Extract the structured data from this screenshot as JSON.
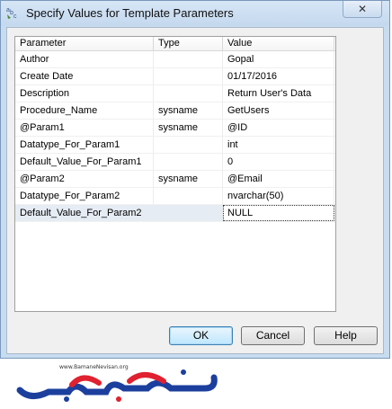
{
  "window": {
    "title": "Specify Values for Template Parameters",
    "close_glyph": "✕"
  },
  "grid": {
    "columns": [
      "Parameter",
      "Type",
      "Value"
    ],
    "rows": [
      {
        "parameter": "Author",
        "type": "",
        "value": "Gopal"
      },
      {
        "parameter": "Create Date",
        "type": "",
        "value": "01/17/2016"
      },
      {
        "parameter": "Description",
        "type": "",
        "value": "Return User's Data"
      },
      {
        "parameter": "Procedure_Name",
        "type": "sysname",
        "value": "GetUsers"
      },
      {
        "parameter": "@Param1",
        "type": "sysname",
        "value": "@ID"
      },
      {
        "parameter": "Datatype_For_Param1",
        "type": "",
        "value": "int"
      },
      {
        "parameter": "Default_Value_For_Param1",
        "type": "",
        "value": "0"
      },
      {
        "parameter": "@Param2",
        "type": "sysname",
        "value": "@Email"
      },
      {
        "parameter": "Datatype_For_Param2",
        "type": "",
        "value": "nvarchar(50)"
      },
      {
        "parameter": "Default_Value_For_Param2",
        "type": "",
        "value": "NULL"
      }
    ],
    "selected_row": 9
  },
  "buttons": {
    "ok": "OK",
    "cancel": "Cancel",
    "help": "Help"
  },
  "watermark": {
    "text": "www.BamaneNevisan.org",
    "brand_colors": [
      "#1c3f9e",
      "#e0212f"
    ]
  },
  "icons": {
    "app": "template-abc-icon",
    "close": "close-icon"
  }
}
